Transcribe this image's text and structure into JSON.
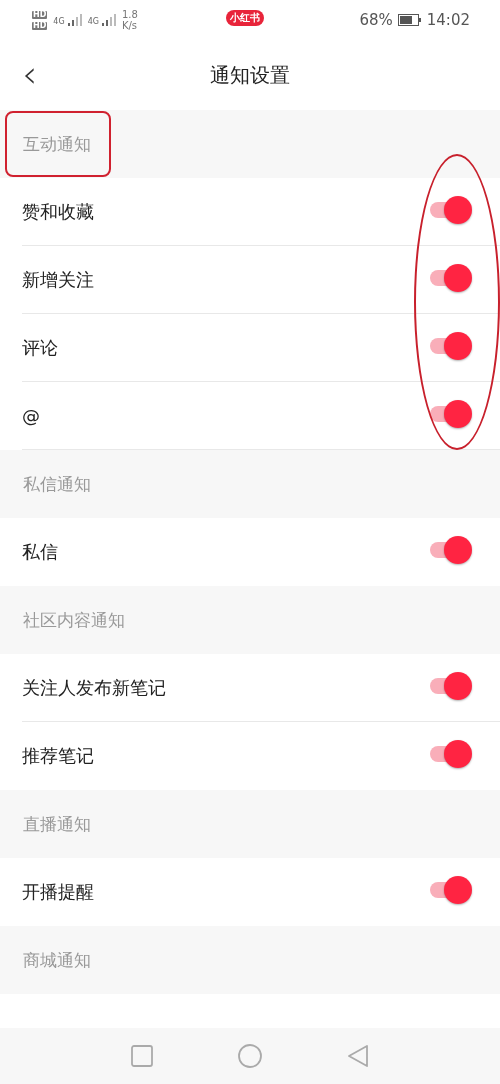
{
  "status_bar": {
    "sim_labels": [
      "HD",
      "HD"
    ],
    "network_labels": [
      "4G",
      "4G"
    ],
    "speed": "1.8",
    "speed_unit": "K/s",
    "app_badge": "小红书",
    "battery": "68%",
    "time": "14:02"
  },
  "header": {
    "back": "‹",
    "title": "通知设置"
  },
  "sections": [
    {
      "title": "互动通知",
      "highlighted": true,
      "toggles_circled": true,
      "items": [
        {
          "label": "赞和收藏",
          "on": true
        },
        {
          "label": "新增关注",
          "on": true
        },
        {
          "label": "评论",
          "on": true
        },
        {
          "label": "@",
          "on": true
        }
      ]
    },
    {
      "title": "私信通知",
      "highlighted": false,
      "toggles_circled": false,
      "items": [
        {
          "label": "私信",
          "on": true
        }
      ]
    },
    {
      "title": "社区内容通知",
      "highlighted": false,
      "toggles_circled": false,
      "items": [
        {
          "label": "关注人发布新笔记",
          "on": true
        },
        {
          "label": "推荐笔记",
          "on": true
        }
      ]
    },
    {
      "title": "直播通知",
      "highlighted": false,
      "toggles_circled": false,
      "items": [
        {
          "label": "开播提醒",
          "on": true
        }
      ]
    },
    {
      "title": "商城通知",
      "highlighted": false,
      "toggles_circled": false
    }
  ]
}
